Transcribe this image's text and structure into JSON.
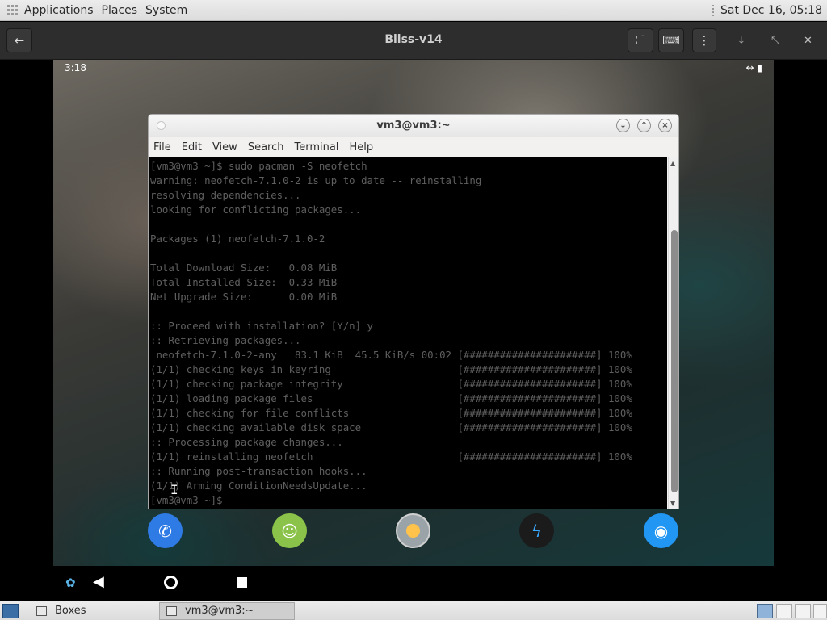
{
  "top_panel": {
    "menus": [
      "Applications",
      "Places",
      "System"
    ],
    "clock": "Sat Dec 16, 05:18"
  },
  "boxes_header": {
    "vm_title": "Bliss-v14"
  },
  "android": {
    "time": "3:18",
    "status": "↔ ▮"
  },
  "terminal": {
    "title": "vm3@vm3:~",
    "menu": [
      "File",
      "Edit",
      "View",
      "Search",
      "Terminal",
      "Help"
    ],
    "output": "[vm3@vm3 ~]$ sudo pacman -S neofetch\nwarning: neofetch-7.1.0-2 is up to date -- reinstalling\nresolving dependencies...\nlooking for conflicting packages...\n\nPackages (1) neofetch-7.1.0-2\n\nTotal Download Size:   0.08 MiB\nTotal Installed Size:  0.33 MiB\nNet Upgrade Size:      0.00 MiB\n\n:: Proceed with installation? [Y/n] y\n:: Retrieving packages...\n neofetch-7.1.0-2-any   83.1 KiB  45.5 KiB/s 00:02 [######################] 100%\n(1/1) checking keys in keyring                     [######################] 100%\n(1/1) checking package integrity                   [######################] 100%\n(1/1) loading package files                        [######################] 100%\n(1/1) checking for file conflicts                  [######################] 100%\n(1/1) checking available disk space                [######################] 100%\n:: Processing package changes...\n(1/1) reinstalling neofetch                        [######################] 100%\n:: Running post-transaction hooks...\n(1/1) Arming ConditionNeedsUpdate...\n[vm3@vm3 ~]$ "
  },
  "taskbar": {
    "tasks": [
      "Boxes",
      "vm3@vm3:~"
    ]
  },
  "icons": {
    "back": "←",
    "fullscreen": "⛶",
    "keyboard": "⌨",
    "menu": "⋮",
    "download": "⤓",
    "unmaximize": "⤡",
    "close": "✕",
    "phone": "✆",
    "messages": "☺",
    "storm": "ϟ",
    "camera": "◉",
    "lotus": "✿",
    "nav_back": "◀"
  }
}
